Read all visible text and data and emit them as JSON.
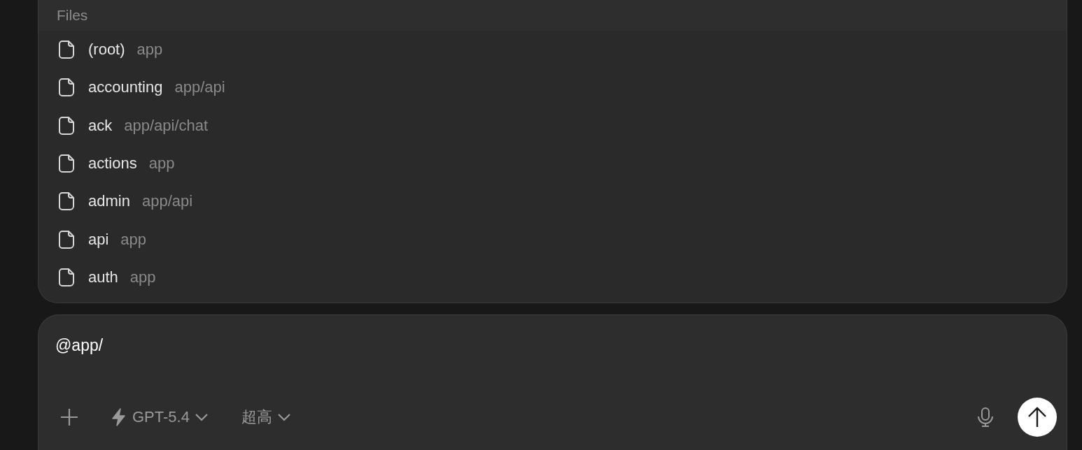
{
  "files_popup": {
    "heading": "Files",
    "items": [
      {
        "name": "(root)",
        "path": "app"
      },
      {
        "name": "accounting",
        "path": "app/api"
      },
      {
        "name": "ack",
        "path": "app/api/chat"
      },
      {
        "name": "actions",
        "path": "app"
      },
      {
        "name": "admin",
        "path": "app/api"
      },
      {
        "name": "api",
        "path": "app"
      },
      {
        "name": "auth",
        "path": "app"
      }
    ]
  },
  "composer": {
    "value": "@app/",
    "model": "GPT-5.4",
    "effort": "超高"
  }
}
